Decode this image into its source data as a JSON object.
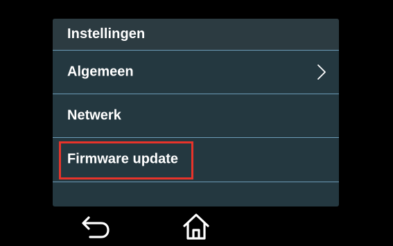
{
  "settings": {
    "title": "Instellingen",
    "items": [
      {
        "label": "Algemeen",
        "has_chevron": true,
        "icon": "chevron-right-icon"
      },
      {
        "label": "Netwerk",
        "has_chevron": false
      },
      {
        "label": "Firmware update",
        "has_chevron": false,
        "highlighted": true
      }
    ]
  },
  "navigation": {
    "back_icon": "back-arrow-icon",
    "home_icon": "home-icon"
  },
  "colors": {
    "panel_background": "#243840",
    "divider": "#6d9cb8",
    "highlight_border": "#e8332a",
    "text": "#ffffff"
  }
}
